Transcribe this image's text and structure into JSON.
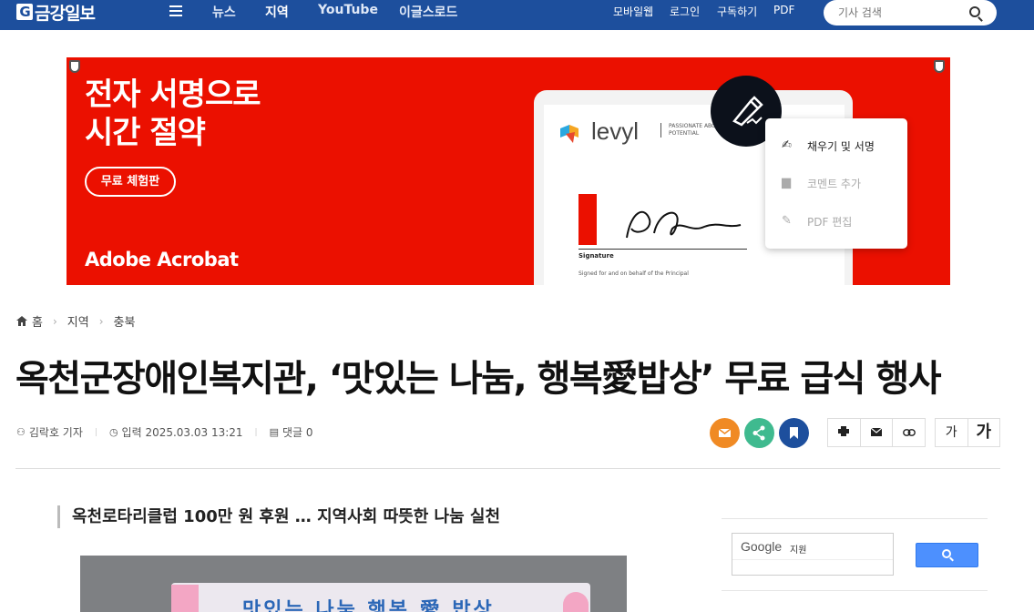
{
  "header": {
    "logo": "금강일보",
    "logo_mark": "G",
    "nav": [
      "뉴스",
      "지역",
      "YouTube",
      "이글스로드"
    ],
    "nav_active": "지역",
    "util": [
      "모바일웹",
      "로그인",
      "구독하기",
      "PDF"
    ],
    "search_placeholder": "기사 검색"
  },
  "ad": {
    "headline_line1": "전자 서명으로",
    "headline_line2": "시간 절약",
    "cta": "무료 체험판",
    "brand": "Adobe Acrobat",
    "doc_logo": "levyl",
    "doc_tagline": "PASSIONATE ABOUT POTENTIAL",
    "doc_signature_label": "Signature",
    "doc_signed_for": "Signed for and on behalf of the Principal",
    "menu": [
      "채우기 및 서명",
      "코멘트 추가",
      "PDF 편집"
    ],
    "accent": "#eb1000"
  },
  "breadcrumb": [
    "홈",
    "지역",
    "충북"
  ],
  "article": {
    "title": "옥천군장애인복지관, ‘맛있는 나눔, 행복愛밥상’ 무료 급식 행사",
    "author": "김락호 기자",
    "date": "입력 2025.03.03 13:21",
    "comments": "댓글 0",
    "subhead": "옥천로타리클럽 100만 원 후원 … 지역사회 따뜻한 나눔 실천",
    "photo_banner_text": "맛있는 나눔 행복 愛 밥상"
  },
  "share_colors": {
    "email": "#f08a24",
    "share": "#3fba8f",
    "bookmark": "#1d4f9d"
  },
  "font_size": {
    "small": "가",
    "large": "가"
  },
  "sidebar": {
    "google_label": "Google",
    "google_input": "지원"
  }
}
